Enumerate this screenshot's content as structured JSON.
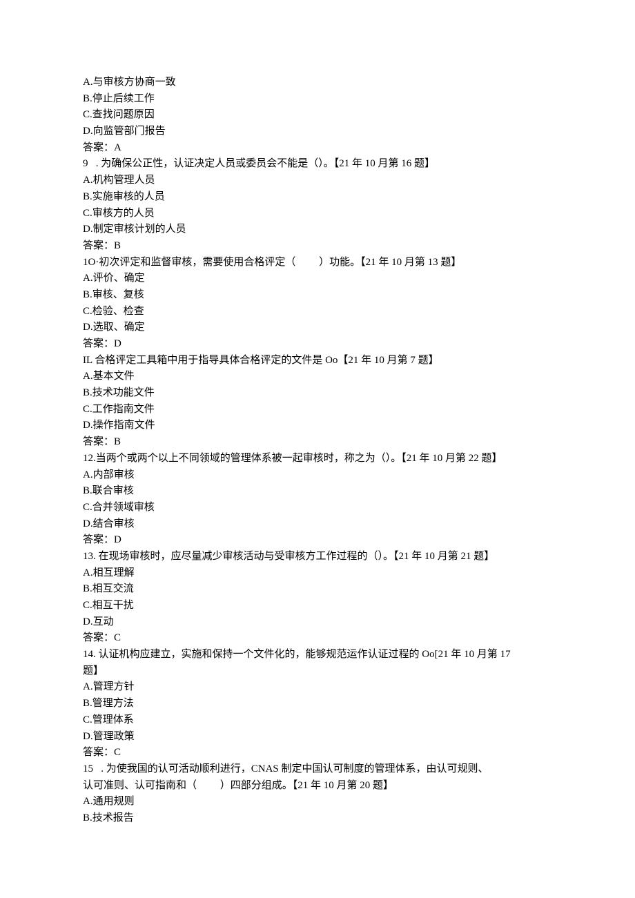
{
  "lines": [
    "A.与审核方协商一致",
    "B.停止后续工作",
    "C.查找问题原因",
    "D.向监管部门报告",
    "答案：A",
    "9   . 为确保公正性，认证决定人员或委员会不能是（）。【21 年 10 月第 16 题】",
    "A.机构管理人员",
    "B.实施审核的人员",
    "C.审核方的人员",
    "D.制定审核计划的人员",
    "答案：B",
    "1O·初次评定和监督审核，需要使用合格评定（         ）功能。【21 年 10 月第 13 题】",
    "A.评价、确定",
    "B.审核、复核",
    "C.检验、检查",
    "D.选取、确定",
    "答案：D",
    "IL 合格评定工具箱中用于指导具体合格评定的文件是 Oo【21 年 10 月第 7 题】",
    "A.基本文件",
    "B.技术功能文件",
    "C.工作指南文件",
    "D.操作指南文件",
    "答案：B",
    "12.当两个或两个以上不同领域的管理体系被一起审核时，称之为（）。【21 年 10 月第 22 题】",
    "A.内部审核",
    "B.联合审核",
    "C.合并领域审核",
    "D.结合审核",
    "答案：D",
    "13. 在现场审核时，应尽量减少审核活动与受审核方工作过程的（）。【21 年 10 月第 21 题】",
    "A.相互理解",
    "B.相互交流",
    "C.相互干扰",
    "D.互动",
    "答案：C",
    "14. 认证机构应建立，实施和保持一个文件化的，能够规范运作认证过程的 Oo[21 年 10 月第 17",
    "题】",
    "A.管理方针",
    "B.管理方法",
    "C.管理体系",
    "D.管理政策",
    "答案：C",
    "15   . 为使我国的认可活动顺利进行，CNAS 制定中国认可制度的管理体系，由认可规则、",
    "认可准则、认可指南和（         ）四部分组成。【21 年 10 月第 20 题】",
    "A.通用规则",
    "B.技术报告"
  ]
}
